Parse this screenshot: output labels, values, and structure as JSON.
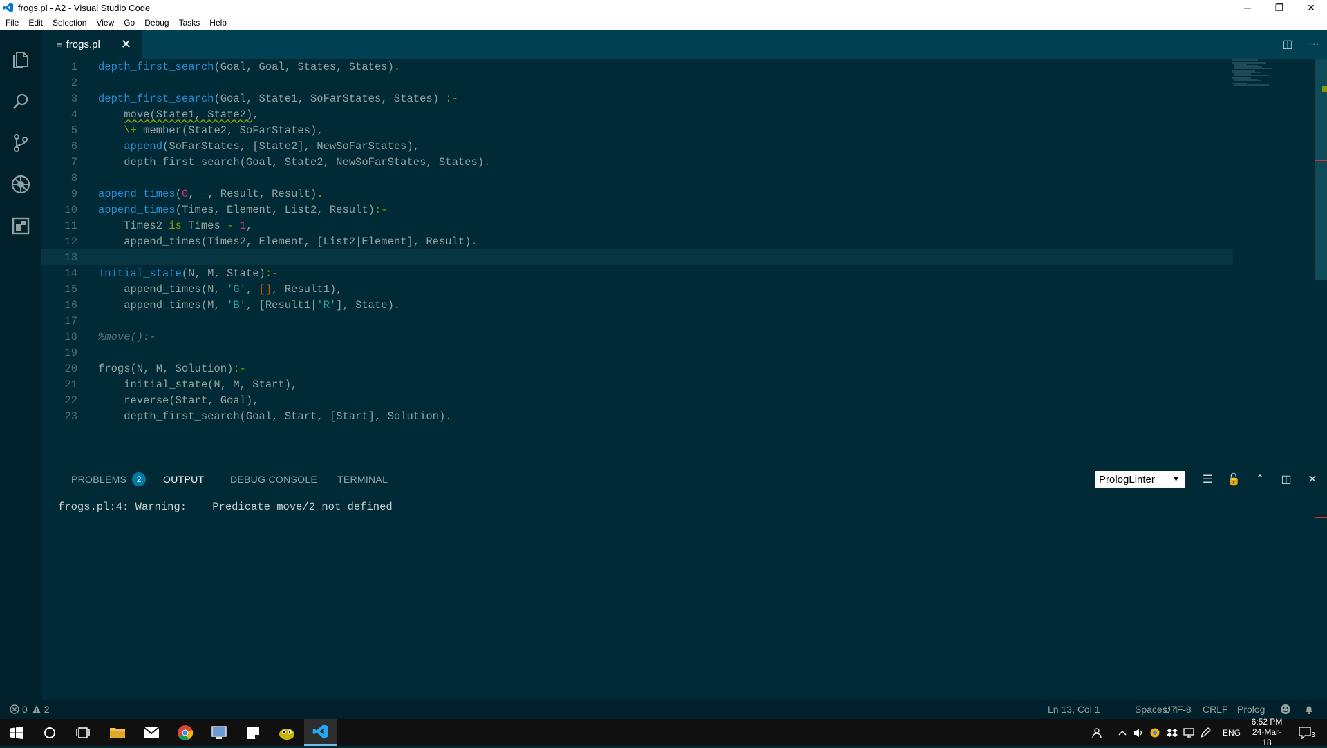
{
  "window": {
    "title": "frogs.pl - A2 - Visual Studio Code",
    "minimize": "─",
    "restore": "❐",
    "close": "✕"
  },
  "menu": [
    "File",
    "Edit",
    "Selection",
    "View",
    "Go",
    "Debug",
    "Tasks",
    "Help"
  ],
  "tab": {
    "label": "frogs.pl",
    "file_icon": "≡",
    "close": "✕"
  },
  "tab_actions": {
    "split": "◫",
    "more": "···"
  },
  "editor": {
    "lines": [
      {
        "n": "1",
        "tokens": [
          [
            "k-fn",
            "depth_first_search"
          ],
          [
            "",
            "(Goal, Goal, States, States)"
          ],
          [
            "k-op",
            "."
          ]
        ]
      },
      {
        "n": "2",
        "tokens": []
      },
      {
        "n": "3",
        "tokens": [
          [
            "k-fn",
            "depth_first_search"
          ],
          [
            "",
            "(Goal, State1, SoFarStates, States) "
          ],
          [
            "k-op",
            ":-"
          ]
        ]
      },
      {
        "n": "4",
        "tokens": [
          [
            "",
            "    "
          ],
          [
            "squig",
            "move(State1, State2)"
          ],
          [
            "",
            ","
          ]
        ]
      },
      {
        "n": "5",
        "tokens": [
          [
            "",
            "    "
          ],
          [
            "k-op",
            "\\+"
          ],
          [
            "",
            " member(State2, SoFarStates),"
          ]
        ]
      },
      {
        "n": "6",
        "tokens": [
          [
            "",
            "    "
          ],
          [
            "k-fn",
            "append"
          ],
          [
            "",
            "(SoFarStates, [State2], NewSoFarStates),"
          ]
        ]
      },
      {
        "n": "7",
        "tokens": [
          [
            "",
            "    depth_first_search(Goal, State2, NewSoFarStates, States)"
          ],
          [
            "k-op",
            "."
          ]
        ]
      },
      {
        "n": "8",
        "tokens": []
      },
      {
        "n": "9",
        "tokens": [
          [
            "k-fn",
            "append_times"
          ],
          [
            "",
            "("
          ],
          [
            "k-num",
            "0"
          ],
          [
            "",
            ", "
          ],
          [
            "k-op",
            "_"
          ],
          [
            "",
            ", Result, Result)"
          ],
          [
            "k-op",
            "."
          ]
        ]
      },
      {
        "n": "10",
        "tokens": [
          [
            "k-fn",
            "append_times"
          ],
          [
            "",
            "(Times, Element, List2, Result)"
          ],
          [
            "k-op",
            ":-"
          ]
        ]
      },
      {
        "n": "11",
        "tokens": [
          [
            "",
            "    Times2 "
          ],
          [
            "k-op",
            "is"
          ],
          [
            "",
            " Times "
          ],
          [
            "k-op",
            "-"
          ],
          [
            "",
            ""
          ],
          [
            "k-num",
            " 1"
          ],
          [
            "",
            ","
          ]
        ]
      },
      {
        "n": "12",
        "tokens": [
          [
            "",
            "    append_times(Times2, Element, [List2|Element], Result)"
          ],
          [
            "k-op",
            "."
          ]
        ]
      },
      {
        "n": "13",
        "tokens": []
      },
      {
        "n": "14",
        "tokens": [
          [
            "k-fn",
            "initial_state"
          ],
          [
            "",
            "(N, M, State)"
          ],
          [
            "k-op",
            ":-"
          ]
        ]
      },
      {
        "n": "15",
        "tokens": [
          [
            "",
            "    append_times(N, "
          ],
          [
            "k-str",
            "'G'"
          ],
          [
            "",
            ", "
          ],
          [
            "k-list",
            "[]"
          ],
          [
            "",
            ", Result1),"
          ]
        ]
      },
      {
        "n": "16",
        "tokens": [
          [
            "",
            "    append_times(M, "
          ],
          [
            "k-str",
            "'B'"
          ],
          [
            "",
            ", [Result1|"
          ],
          [
            "k-str",
            "'R'"
          ],
          [
            "",
            "], State)"
          ],
          [
            "k-op",
            "."
          ]
        ]
      },
      {
        "n": "17",
        "tokens": []
      },
      {
        "n": "18",
        "tokens": [
          [
            "k-com",
            "%move():-"
          ]
        ]
      },
      {
        "n": "19",
        "tokens": []
      },
      {
        "n": "20",
        "tokens": [
          [
            "",
            "frogs(N, M, Solution)"
          ],
          [
            "k-op",
            ":-"
          ]
        ]
      },
      {
        "n": "21",
        "tokens": [
          [
            "",
            "    initial_state(N, M, Start),"
          ]
        ]
      },
      {
        "n": "22",
        "tokens": [
          [
            "",
            "    reverse(Start, Goal),"
          ]
        ]
      },
      {
        "n": "23",
        "tokens": [
          [
            "",
            "    depth_first_search(Goal, Start, [Start], Solution)"
          ],
          [
            "k-op",
            "."
          ]
        ]
      }
    ]
  },
  "panel": {
    "tabs": [
      {
        "label": "PROBLEMS",
        "badge": "2"
      },
      {
        "label": "OUTPUT"
      },
      {
        "label": "DEBUG CONSOLE"
      },
      {
        "label": "TERMINAL"
      }
    ],
    "channel": "PrologLinter",
    "dropdown_arrow": "▼",
    "output_text": "frogs.pl:4: Warning:    Predicate move/2 not defined",
    "actions": {
      "clear": "☰",
      "lock": "🔓",
      "maximize": "⌃",
      "split": "◫",
      "close": "✕"
    }
  },
  "status": {
    "errors": "0",
    "warnings": "2",
    "position": "Ln 13, Col 1",
    "spaces": "Spaces: 4",
    "encoding": "UTF-8",
    "eol": "CRLF",
    "language": "Prolog"
  },
  "taskbar": {
    "language": "ENG",
    "time": "6:52 PM",
    "date": "24-Mar-18",
    "notifications": "3"
  },
  "colors": {
    "editor_bg": "#002b36",
    "activity_bg": "#00212b",
    "tabs_bg": "#004052",
    "keyword_blue": "#268bd2",
    "keyword_green": "#859900",
    "string_cyan": "#2aa198",
    "number_magenta": "#d33682",
    "list_orange": "#cb4b16",
    "badge": "#047aa6"
  }
}
